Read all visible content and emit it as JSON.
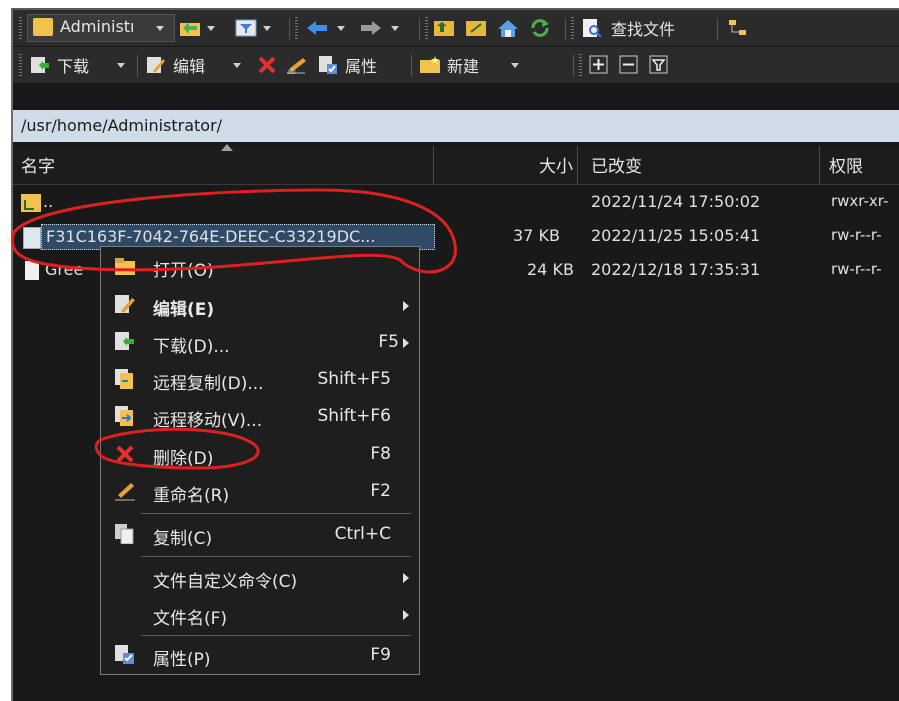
{
  "toolbar1": {
    "dir_label": "Administı",
    "find_files_label": "查找文件"
  },
  "toolbar2": {
    "download_label": "下载",
    "edit_label": "编辑",
    "properties_label": "属性",
    "new_label": "新建"
  },
  "path": "/usr/home/Administrator/",
  "columns": {
    "name": "名字",
    "size": "大小",
    "changed": "已改变",
    "rights": "权限"
  },
  "files": [
    {
      "name": "..",
      "size": "",
      "changed": "2022/11/24 17:50:02",
      "rights": "rwxr-xr-"
    },
    {
      "name": "F31C163F-7042-764E-DEEC-C33219DC...",
      "size": "37 KB",
      "changed": "2022/11/25 15:05:41",
      "rights": "rw-r--r-"
    },
    {
      "name": "Gree",
      "size": "24 KB",
      "changed": "2022/12/18 17:35:31",
      "rights": "rw-r--r-"
    }
  ],
  "context_menu": {
    "open": "打开(O)",
    "edit": "编辑(E)",
    "download": "下载(D)...",
    "download_shortcut": "F5",
    "remote_copy": "远程复制(D)...",
    "remote_copy_shortcut": "Shift+F5",
    "remote_move": "远程移动(V)...",
    "remote_move_shortcut": "Shift+F6",
    "delete": "删除(D)",
    "delete_shortcut": "F8",
    "rename": "重命名(R)",
    "rename_shortcut": "F2",
    "copy": "复制(C)",
    "copy_shortcut": "Ctrl+C",
    "custom_commands": "文件自定义命令(C)",
    "file_names": "文件名(F)",
    "properties": "属性(P)",
    "properties_shortcut": "F9"
  },
  "colors": {
    "background": "#191919",
    "selection": "#2f4a66",
    "address_bar": "#cfdcea",
    "annotation": "#e02020"
  }
}
